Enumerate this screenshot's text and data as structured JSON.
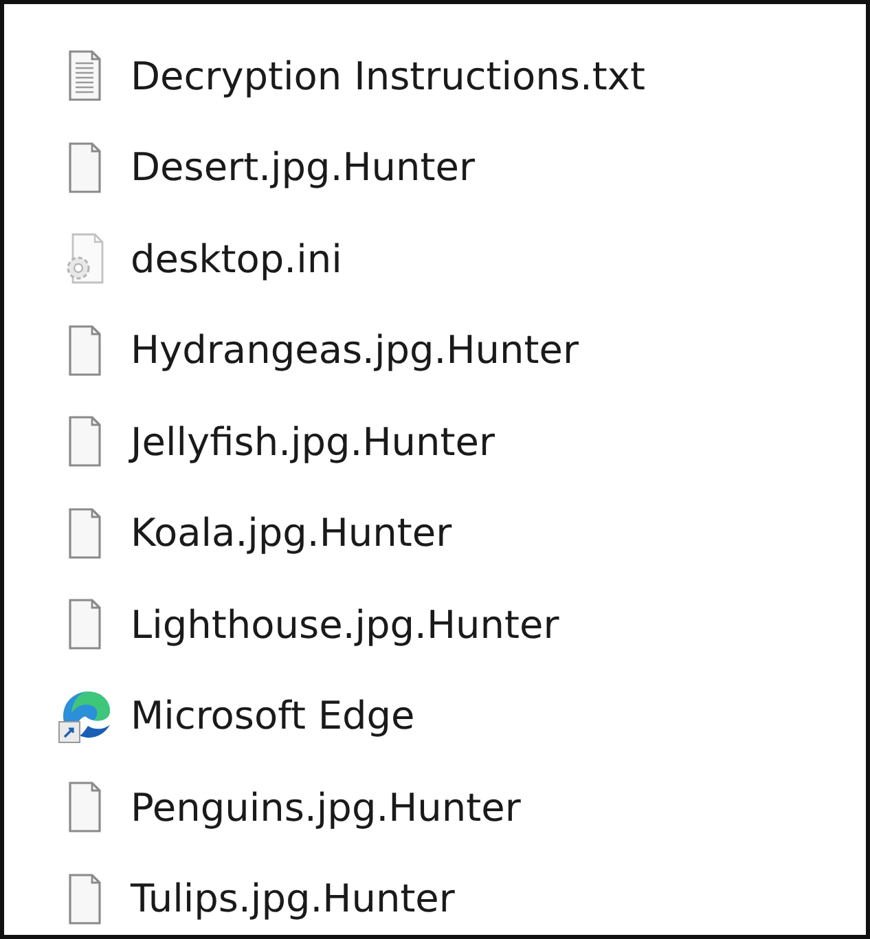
{
  "files": [
    {
      "name": "Decryption Instructions.txt",
      "kind": "text"
    },
    {
      "name": "Desert.jpg.Hunter",
      "kind": "blank"
    },
    {
      "name": "desktop.ini",
      "kind": "settings"
    },
    {
      "name": "Hydrangeas.jpg.Hunter",
      "kind": "blank"
    },
    {
      "name": "Jellyfish.jpg.Hunter",
      "kind": "blank"
    },
    {
      "name": "Koala.jpg.Hunter",
      "kind": "blank"
    },
    {
      "name": "Lighthouse.jpg.Hunter",
      "kind": "blank"
    },
    {
      "name": "Microsoft Edge",
      "kind": "shortcut"
    },
    {
      "name": "Penguins.jpg.Hunter",
      "kind": "blank"
    },
    {
      "name": "Tulips.jpg.Hunter",
      "kind": "blank"
    }
  ]
}
